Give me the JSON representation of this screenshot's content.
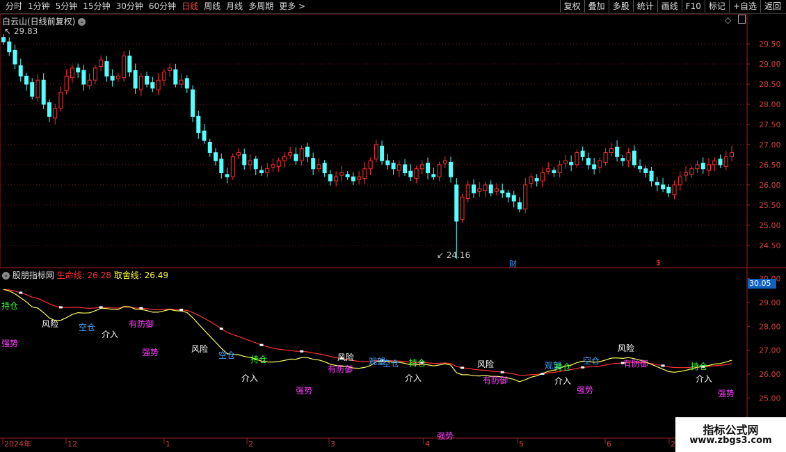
{
  "toolbar": {
    "periods": [
      "分时",
      "1分钟",
      "5分钟",
      "15分钟",
      "30分钟",
      "60分钟",
      "日线",
      "周线",
      "月线",
      "多周期",
      "更多 >"
    ],
    "active": "日线",
    "right_buttons": [
      "复权",
      "叠加",
      "多股",
      "统计",
      "画线",
      "F10",
      "标记",
      "+自选",
      "返回"
    ]
  },
  "main_chart": {
    "title": "白云山(日线前复权)",
    "high_label": "29.83",
    "low_label": "24.16",
    "markers": [
      "财",
      "$"
    ],
    "y_ticks": [
      "29.50",
      "29.00",
      "28.50",
      "28.00",
      "27.50",
      "27.00",
      "26.50",
      "26.00",
      "25.50",
      "25.00",
      "24.50"
    ],
    "colors": {
      "up": "#ff3232",
      "down": "#54ffff",
      "grid": "#801818"
    }
  },
  "indicator": {
    "name": "股朋指标网",
    "life_line_label": "生命线:",
    "life_line_value": "26.28",
    "take_line_label": "取舍线:",
    "take_line_value": "26.49",
    "top_value": "30.05",
    "y_ticks": [
      "30.00",
      "29.00",
      "28.00",
      "27.00",
      "26.00",
      "25.00"
    ],
    "labels": [
      {
        "text": "持仓",
        "color": "#3cff3c"
      },
      {
        "text": "强势",
        "color": "#ff40ff"
      },
      {
        "text": "风险",
        "color": "#ffffff"
      },
      {
        "text": "空仓",
        "color": "#40a0ff"
      },
      {
        "text": "有防御",
        "color": "#ff40ff"
      },
      {
        "text": "介入",
        "color": "#ffffff"
      },
      {
        "text": "强势",
        "color": "#ff40ff"
      },
      {
        "text": "风险",
        "color": "#ffffff"
      },
      {
        "text": "空仓",
        "color": "#40a0ff"
      },
      {
        "text": "持仓",
        "color": "#3cff3c"
      },
      {
        "text": "介入",
        "color": "#ffffff"
      },
      {
        "text": "强势",
        "color": "#ff40ff"
      },
      {
        "text": "风险",
        "color": "#ffffff"
      },
      {
        "text": "有防御",
        "color": "#ff40ff"
      },
      {
        "text": "观望",
        "color": "#40a0ff"
      },
      {
        "text": "空仓",
        "color": "#40a0ff"
      },
      {
        "text": "持仓",
        "color": "#3cff3c"
      },
      {
        "text": "介入",
        "color": "#ffffff"
      },
      {
        "text": "强势",
        "color": "#ff40ff"
      },
      {
        "text": "风险",
        "color": "#ffffff"
      },
      {
        "text": "有防御",
        "color": "#ff40ff"
      },
      {
        "text": "观望",
        "color": "#40a0ff"
      },
      {
        "text": "持仓",
        "color": "#3cff3c"
      },
      {
        "text": "介入",
        "color": "#ffffff"
      },
      {
        "text": "强势",
        "color": "#ff40ff"
      },
      {
        "text": "空仓",
        "color": "#40a0ff"
      },
      {
        "text": "风险",
        "color": "#ffffff"
      },
      {
        "text": "有防御",
        "color": "#ff40ff"
      },
      {
        "text": "持仓",
        "color": "#3cff3c"
      },
      {
        "text": "介入",
        "color": "#ffffff"
      },
      {
        "text": "强势",
        "color": "#ff40ff"
      }
    ]
  },
  "xaxis": {
    "labels": [
      "2024年",
      "12",
      "1",
      "2",
      "3",
      "4",
      "5",
      "6",
      "2"
    ]
  },
  "watermark": {
    "line1": "指标公式网",
    "line2": "www.zbgs3.com"
  },
  "chart_data": {
    "type": "candlestick",
    "ylim": [
      24.1,
      29.95
    ],
    "y_ticks": [
      29.5,
      29.0,
      28.5,
      28.0,
      27.5,
      27.0,
      26.5,
      26.0,
      25.5,
      25.0,
      24.5
    ],
    "candles_close": [
      29.55,
      29.3,
      29.0,
      28.7,
      28.5,
      28.2,
      28.6,
      28.0,
      27.7,
      27.9,
      28.3,
      28.7,
      28.9,
      28.8,
      28.5,
      28.6,
      28.9,
      29.1,
      28.7,
      28.6,
      28.7,
      29.2,
      28.8,
      28.4,
      28.7,
      28.5,
      28.4,
      28.6,
      28.8,
      28.9,
      28.5,
      28.6,
      28.4,
      27.7,
      27.3,
      27.1,
      26.8,
      26.6,
      26.3,
      26.2,
      26.7,
      26.8,
      26.5,
      26.6,
      26.4,
      26.3,
      26.4,
      26.5,
      26.6,
      26.7,
      26.8,
      26.6,
      26.9,
      26.7,
      26.4,
      26.5,
      26.3,
      26.1,
      26.2,
      26.3,
      26.2,
      26.1,
      26.2,
      26.4,
      26.6,
      27.0,
      26.6,
      26.5,
      26.4,
      26.5,
      26.3,
      26.2,
      26.4,
      26.5,
      26.3,
      26.2,
      26.5,
      26.6,
      26.2,
      25.1,
      25.7,
      26.0,
      25.8,
      25.9,
      26.0,
      25.8,
      25.9,
      25.8,
      25.7,
      25.6,
      25.4,
      26.0,
      26.2,
      26.1,
      26.3,
      26.4,
      26.3,
      26.5,
      26.6,
      26.5,
      26.8,
      26.7,
      26.5,
      26.4,
      26.6,
      26.8,
      26.9,
      26.7,
      26.6,
      26.8,
      26.5,
      26.4,
      26.3,
      26.1,
      26.0,
      25.9,
      25.8,
      26.0,
      26.2,
      26.3,
      26.4,
      26.5,
      26.4,
      26.5,
      26.6,
      26.5,
      26.7,
      26.8
    ],
    "low_value": 24.16,
    "high_value": 29.83,
    "indicator_ylim": [
      23.9,
      30.05
    ],
    "life_line": 26.28,
    "take_line": 26.49
  }
}
